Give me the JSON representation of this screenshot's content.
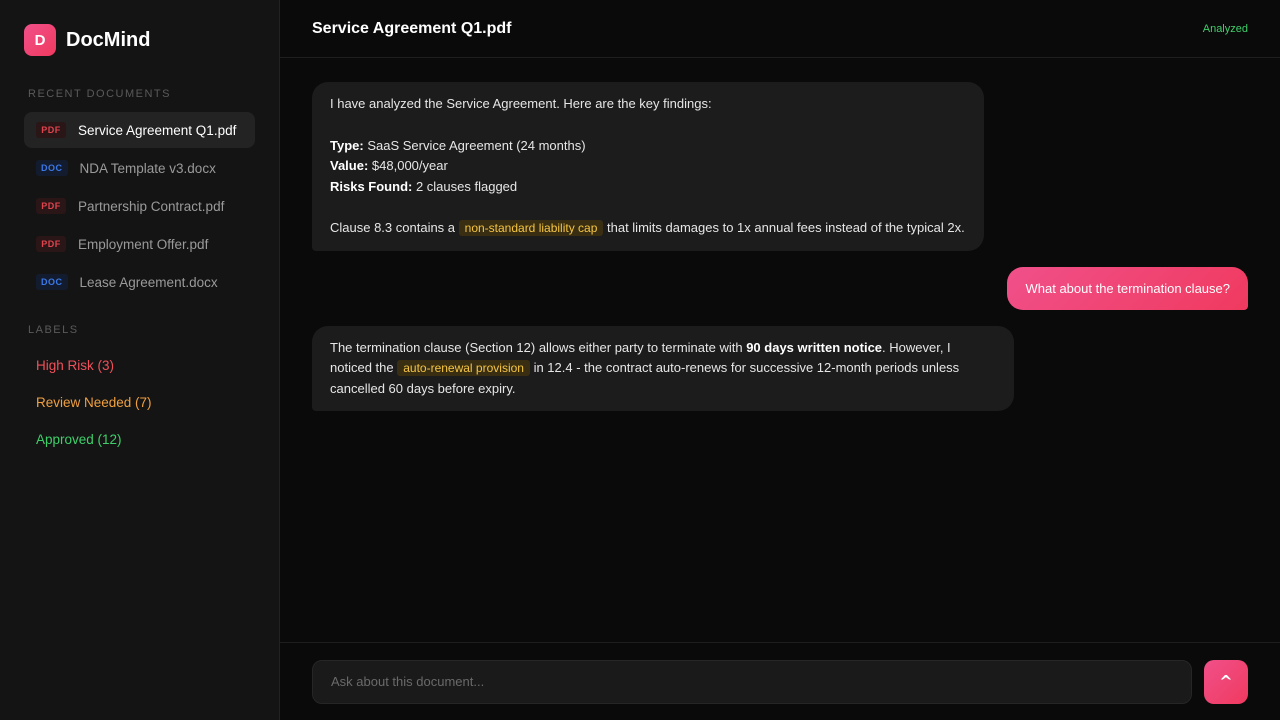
{
  "brand": {
    "logo_letter": "D",
    "name": "DocMind"
  },
  "sidebar": {
    "recent_title": "RECENT DOCUMENTS",
    "documents": [
      {
        "type": "PDF",
        "name": "Service Agreement Q1.pdf",
        "active": true
      },
      {
        "type": "DOC",
        "name": "NDA Template v3.docx",
        "active": false
      },
      {
        "type": "PDF",
        "name": "Partnership Contract.pdf",
        "active": false
      },
      {
        "type": "PDF",
        "name": "Employment Offer.pdf",
        "active": false
      },
      {
        "type": "DOC",
        "name": "Lease Agreement.docx",
        "active": false
      }
    ],
    "labels_title": "LABELS",
    "labels": [
      {
        "text": "High Risk (3)",
        "color": "#f0505a"
      },
      {
        "text": "Review Needed (7)",
        "color": "#f0a040"
      },
      {
        "text": "Approved (12)",
        "color": "#3fcf6a"
      }
    ]
  },
  "header": {
    "title": "Service Agreement Q1.pdf",
    "status": "Analyzed"
  },
  "messages": {
    "m1": {
      "intro": "I have analyzed the Service Agreement. Here are the key findings:",
      "type_label": "Type:",
      "type_value": " SaaS Service Agreement (24 months)",
      "value_label": "Value:",
      "value_value": " $48,000/year",
      "risks_label": "Risks Found:",
      "risks_value": " 2 clauses flagged",
      "clause_pre": "Clause 8.3 contains a ",
      "clause_hl": "non-standard liability cap",
      "clause_post": " that limits damages to 1x annual fees instead of the typical 2x."
    },
    "m2": {
      "text": "What about the termination clause?"
    },
    "m3": {
      "pre": "The termination clause (Section 12) allows either party to terminate with ",
      "bold": "90 days written notice",
      "mid": ". However, I noticed the ",
      "hl": "auto-renewal provision",
      "post": " in 12.4 - the contract auto-renews for successive 12-month periods unless cancelled 60 days before expiry."
    }
  },
  "composer": {
    "placeholder": "Ask about this document...",
    "send_label": "^"
  },
  "colors": {
    "accent": "#f0508a",
    "highlight": "#f5c542",
    "success": "#3fcf6a"
  }
}
